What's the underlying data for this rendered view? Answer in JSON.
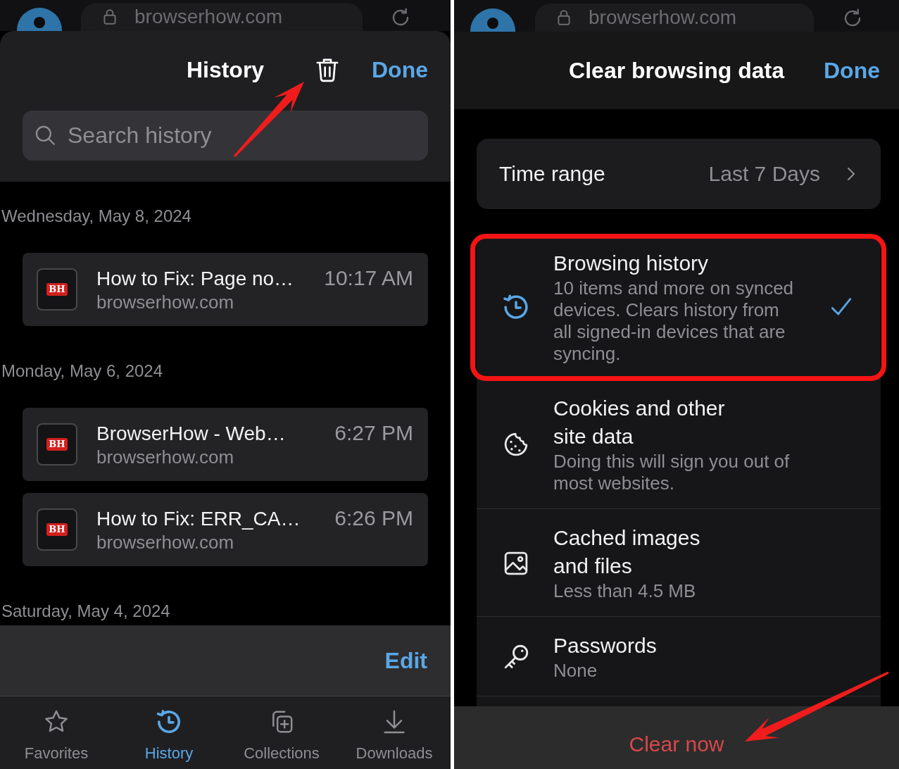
{
  "history_screen": {
    "top_bar": {
      "url": "browserhow.com"
    },
    "header": {
      "title": "History",
      "done": "Done"
    },
    "search": {
      "placeholder": "Search history"
    },
    "groups": [
      {
        "date": "Wednesday, May 8, 2024",
        "entries": [
          {
            "favicon": "BH",
            "title": "How to Fix: Page no…",
            "url": "browserhow.com",
            "time": "10:17 AM"
          }
        ]
      },
      {
        "date": "Monday, May 6, 2024",
        "entries": [
          {
            "favicon": "BH",
            "title": "BrowserHow - Web…",
            "url": "browserhow.com",
            "time": "6:27 PM"
          },
          {
            "favicon": "BH",
            "title": "How to Fix: ERR_CA…",
            "url": "browserhow.com",
            "time": "6:26 PM"
          }
        ]
      },
      {
        "date": "Saturday, May 4, 2024"
      }
    ],
    "toolbar": {
      "edit": "Edit"
    },
    "tabs": [
      {
        "kind": "favorites",
        "label": "Favorites",
        "selected": false
      },
      {
        "kind": "history",
        "label": "History",
        "selected": true
      },
      {
        "kind": "collections",
        "label": "Collections",
        "selected": false
      },
      {
        "kind": "downloads",
        "label": "Downloads",
        "selected": false
      }
    ]
  },
  "clear_screen": {
    "top_bar": {
      "url": "browserhow.com"
    },
    "header": {
      "title": "Clear browsing data",
      "done": "Done"
    },
    "time_range": {
      "label": "Time range",
      "value": "Last 7 Days"
    },
    "options": [
      {
        "kind": "history",
        "title": "Browsing history",
        "description": "10 items and more on synced devices. Clears history from all signed-in devices that are syncing.",
        "checked": true,
        "highlighted": true
      },
      {
        "kind": "cookies",
        "title": "Cookies and other site data",
        "description": "Doing this will sign you out of most websites.",
        "checked": false,
        "highlighted": false
      },
      {
        "kind": "cache",
        "title": "Cached images and files",
        "description": "Less than 4.5 MB",
        "checked": false,
        "highlighted": false
      },
      {
        "kind": "passwords",
        "title": "Passwords",
        "description": "None",
        "checked": false,
        "highlighted": false
      }
    ],
    "action": "Clear now"
  }
}
